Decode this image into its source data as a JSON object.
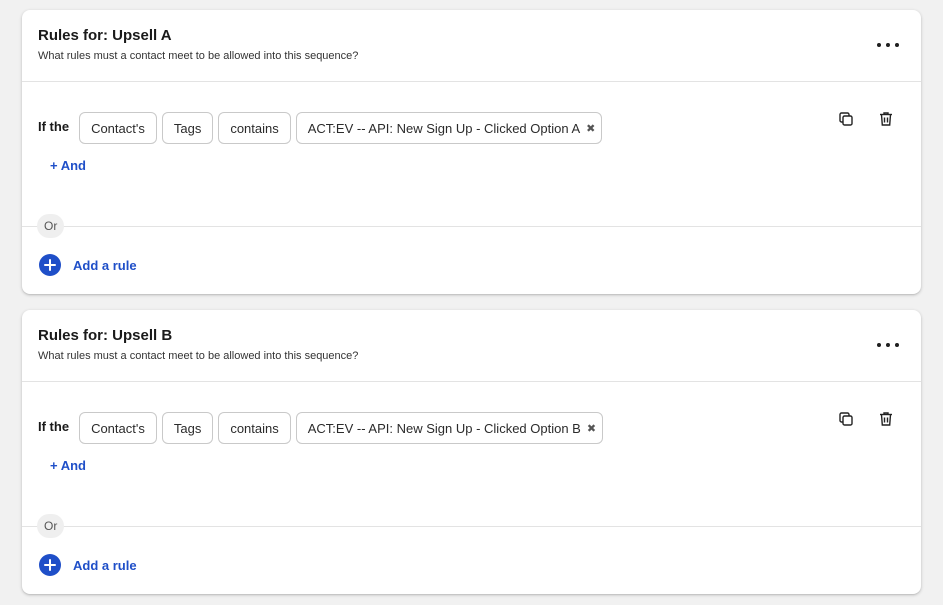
{
  "cards": [
    {
      "title": "Rules for: Upsell A",
      "subtitle": "What rules must a contact meet to be allowed into this sequence?",
      "rule": {
        "prefix": "If the",
        "field_scope": "Contact's",
        "field": "Tags",
        "operator": "contains",
        "value": "ACT:EV -- API: New Sign Up - Clicked Option A",
        "remove_glyph": "✖"
      },
      "and_label": "+ And",
      "or_label": "Or",
      "add_rule_label": "Add a rule"
    },
    {
      "title": "Rules for: Upsell B",
      "subtitle": "What rules must a contact meet to be allowed into this sequence?",
      "rule": {
        "prefix": "If the",
        "field_scope": "Contact's",
        "field": "Tags",
        "operator": "contains",
        "value": "ACT:EV -- API: New Sign Up - Clicked Option B",
        "remove_glyph": "✖"
      },
      "and_label": "+ And",
      "or_label": "Or",
      "add_rule_label": "Add a rule"
    }
  ],
  "icons": {
    "more": "more-horizontal-icon",
    "copy": "copy-icon",
    "delete": "trash-icon",
    "add": "plus-circle-icon"
  },
  "colors": {
    "accent": "#1f4fc8",
    "background": "#f1f1f1",
    "card": "#ffffff"
  }
}
